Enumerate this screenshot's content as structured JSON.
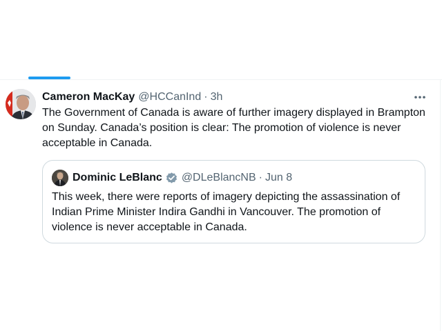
{
  "tweet": {
    "author_name": "Cameron MacKay",
    "handle": "@HCCanInd",
    "separator": "·",
    "time": "3h",
    "more_icon": "more-horizontal-icon",
    "text": "The Government of Canada is aware of further imagery displayed in Brampton on Sunday. Canada’s position is clear: The promotion of violence is never acceptable in Canada."
  },
  "quote": {
    "author_name": "Dominic LeBlanc",
    "verified_icon": "verified-badge-icon",
    "handle": "@DLeBlancNB",
    "separator": "·",
    "date": "Jun 8",
    "text": "This week, there were reports of imagery depicting the assassination of Indian Prime Minister Indira Gandhi in Vancouver. The promotion of violence is never acceptable in Canada."
  },
  "colors": {
    "accent": "#1d9bf0",
    "secondary_text": "#536471",
    "border": "#cfd9de"
  }
}
